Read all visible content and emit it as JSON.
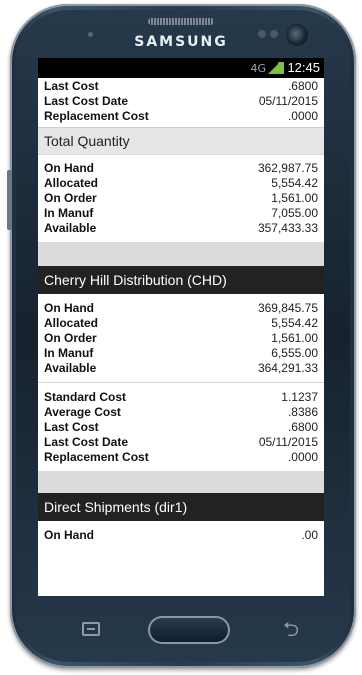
{
  "device": {
    "brand": "SAMSUNG"
  },
  "statusbar": {
    "time": "12:45",
    "network": "4G"
  },
  "top_cost": {
    "rows": [
      {
        "label": "Last Cost",
        "value": ".6800"
      },
      {
        "label": "Last Cost Date",
        "value": "05/11/2015"
      },
      {
        "label": "Replacement Cost",
        "value": ".0000"
      }
    ]
  },
  "total_quantity": {
    "title": "Total Quantity",
    "rows": [
      {
        "label": "On Hand",
        "value": "362,987.75"
      },
      {
        "label": "Allocated",
        "value": "5,554.42"
      },
      {
        "label": "On Order",
        "value": "1,561.00"
      },
      {
        "label": "In Manuf",
        "value": "7,055.00"
      },
      {
        "label": "Available",
        "value": "357,433.33"
      }
    ]
  },
  "chd": {
    "title": "Cherry Hill Distribution (CHD)",
    "quantity_rows": [
      {
        "label": "On Hand",
        "value": "369,845.75"
      },
      {
        "label": "Allocated",
        "value": "5,554.42"
      },
      {
        "label": "On Order",
        "value": "1,561.00"
      },
      {
        "label": "In Manuf",
        "value": "6,555.00"
      },
      {
        "label": "Available",
        "value": "364,291.33"
      }
    ],
    "cost_rows": [
      {
        "label": "Standard Cost",
        "value": "1.1237"
      },
      {
        "label": "Average Cost",
        "value": ".8386"
      },
      {
        "label": "Last Cost",
        "value": ".6800"
      },
      {
        "label": "Last Cost Date",
        "value": "05/11/2015"
      },
      {
        "label": "Replacement Cost",
        "value": ".0000"
      }
    ]
  },
  "dir1": {
    "title": "Direct Shipments (dir1)",
    "rows": [
      {
        "label": "On Hand",
        "value": ".00"
      }
    ]
  }
}
